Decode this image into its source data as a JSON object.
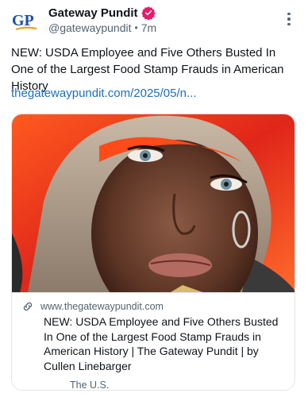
{
  "account": {
    "avatar_text": "GP",
    "display_name": "Gateway Pundit",
    "handle": "@gatewaypundit",
    "separator": "•",
    "time_ago": "7m"
  },
  "post": {
    "text": "NEW: USDA Employee and Five Others Busted In One of the Largest Food Stamp Frauds in American History",
    "link_text": "thegatewaypundit.com/2025/05/n..."
  },
  "card": {
    "domain": "www.thegatewaypundit.com",
    "title": "NEW: USDA Employee and Five Others Busted In One of the Largest Food Stamp Frauds in American History | The Gateway Pundit | by Cullen Linebarger",
    "category": "The U.S."
  },
  "icons": {
    "verified": "verified-badge-icon",
    "more": "more-options-icon",
    "link": "link-icon"
  },
  "colors": {
    "verified_badge": "#f0166a",
    "link": "#1d6fb8",
    "logo_blue": "#1e4fa8",
    "logo_gold": "#e8a21a"
  }
}
